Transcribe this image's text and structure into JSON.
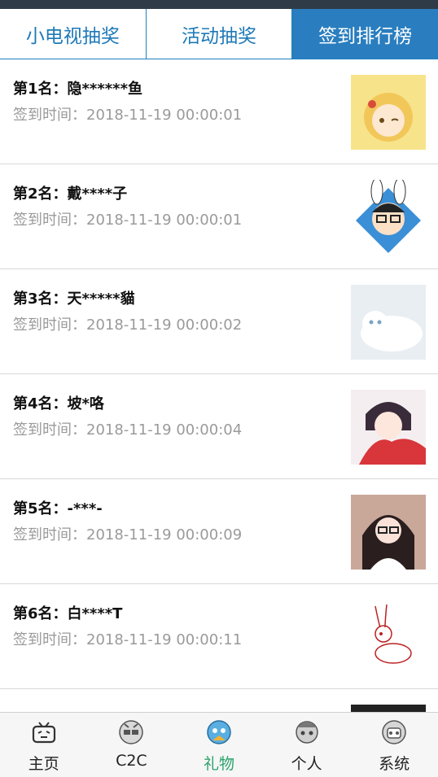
{
  "tabs": [
    {
      "label": "小电视抽奖"
    },
    {
      "label": "活动抽奖"
    },
    {
      "label": "签到排行榜"
    }
  ],
  "rankings": [
    {
      "name": "第1名：隐******鱼",
      "time": "签到时间：2018-11-19 00:00:01",
      "avatar": "anime-girl-avatar"
    },
    {
      "name": "第2名：戴****子",
      "time": "签到时间：2018-11-19 00:00:01",
      "avatar": "bunny-boy-avatar"
    },
    {
      "name": "第3名：天*****貓",
      "time": "签到时间：2018-11-19 00:00:02",
      "avatar": "white-cat-avatar"
    },
    {
      "name": "第4名：坡*咯",
      "time": "签到时间：2018-11-19 00:00:04",
      "avatar": "anime-boy-scarf-avatar"
    },
    {
      "name": "第5名：-***-",
      "time": "签到时间：2018-11-19 00:00:09",
      "avatar": "girl-glasses-avatar"
    },
    {
      "name": "第6名：白****T",
      "time": "签到时间：2018-11-19 00:00:11",
      "avatar": "sketch-rabbit-avatar"
    }
  ],
  "nav": [
    {
      "label": "主页",
      "icon": "tv-icon"
    },
    {
      "label": "C2C",
      "icon": "mascot-icon"
    },
    {
      "label": "礼物",
      "icon": "gift-mascot-icon",
      "active": true
    },
    {
      "label": "个人",
      "icon": "person-mascot-icon"
    },
    {
      "label": "系统",
      "icon": "system-mascot-icon"
    }
  ],
  "colors": {
    "accent": "#2a7ebf",
    "active_nav": "#2aa26a"
  }
}
